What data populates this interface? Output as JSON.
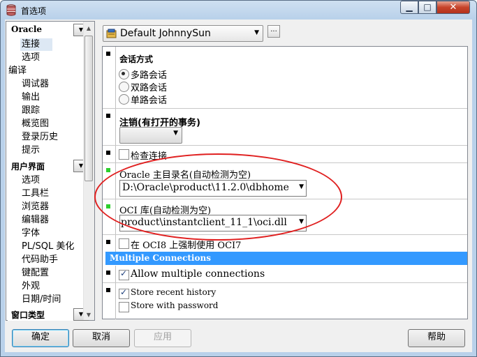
{
  "window": {
    "title": "首选项",
    "minimize_glyph": "▁",
    "maximize_glyph": "□",
    "close_glyph": "✕"
  },
  "nav": {
    "groups": [
      {
        "title": "Oracle",
        "items": [
          "连接",
          "选项"
        ]
      },
      {
        "title": "编译",
        "items": [
          "调试器",
          "输出",
          "跟踪",
          "概览图",
          "登录历史",
          "提示"
        ]
      },
      {
        "title": "用户界面",
        "items": [
          "选项",
          "工具栏",
          "浏览器",
          "编辑器",
          "字体",
          "PL/SQL 美化",
          "代码助手",
          "键配置",
          "外观",
          "日期/时间"
        ]
      },
      {
        "title": "窗口类型",
        "items": []
      }
    ],
    "selected": "连接",
    "dropdown_glyph": "▼"
  },
  "profile": {
    "value": "Default JohnnySun",
    "more_label": "..."
  },
  "sections": {
    "session_mode": {
      "title": "会话方式",
      "options": [
        "多路会话",
        "双路会话",
        "单路会话"
      ],
      "selected": "多路会话"
    },
    "logoff": {
      "title": "注销(有打开的事务)",
      "value": ""
    },
    "check_connection": {
      "label": "检查连接",
      "checked": false
    },
    "oracle_home": {
      "label": "Oracle 主目录名(自动检测为空)",
      "value": "D:\\Oracle\\product\\11.2.0\\dbhome"
    },
    "oci_library": {
      "label": "OCI 库(自动检测为空)",
      "value": "product\\instantclient_11_1\\oci.dll"
    },
    "oci7": {
      "label": "在 OCI8 上强制使用 OCI7",
      "checked": false
    },
    "multiple_connections": {
      "header": "Multiple Connections",
      "allow": {
        "label": "Allow multiple connections",
        "checked": true
      },
      "store_history": {
        "label": "Store recent history",
        "checked": true
      },
      "store_password": {
        "label": "Store with password",
        "checked": false
      }
    }
  },
  "buttons": {
    "ok": "确定",
    "cancel": "取消",
    "apply": "应用",
    "help": "帮助"
  },
  "colors": {
    "accent": "#3399ff",
    "annotation": "#e02020",
    "marker_changed": "#2ccf2c"
  },
  "icons": {
    "app": "database-preferences-icon",
    "profile": "profile-icon"
  }
}
